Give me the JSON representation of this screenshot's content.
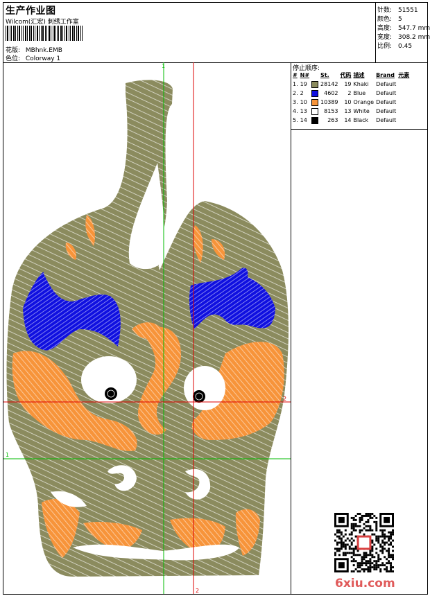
{
  "header": {
    "title": "生产作业图",
    "subtitle": "Wilcom(汇宏) 刺绣工作室",
    "pattern_label": "花版:",
    "pattern_value": "MBhnk.EMB",
    "colorway_label": "色位:",
    "colorway_value": "Colorway 1"
  },
  "stats": {
    "stitches_label": "针数:",
    "stitches_value": "51551",
    "colors_label": "颜色:",
    "colors_value": "5",
    "height_label": "高度:",
    "height_value": "547.7 mm",
    "width_label": "宽度:",
    "width_value": "308.2 mm",
    "scale_label": "比例:",
    "scale_value": "0.45"
  },
  "stop_sequence": {
    "title": "停止顺序:",
    "headers": [
      "#",
      "N#",
      "St.",
      "代码",
      "描述",
      "Brand",
      "元素"
    ],
    "rows": [
      {
        "idx": "1.",
        "needle": "19",
        "color": "#8b8b5e",
        "stitches": "28142",
        "code": "19",
        "desc": "Khaki",
        "brand": "Default"
      },
      {
        "idx": "2.",
        "needle": "2",
        "color": "#1010e0",
        "stitches": "4602",
        "code": "2",
        "desc": "Blue",
        "brand": "Default"
      },
      {
        "idx": "3.",
        "needle": "10",
        "color": "#f7943a",
        "stitches": "10389",
        "code": "10",
        "desc": "Orange",
        "brand": "Default"
      },
      {
        "idx": "4.",
        "needle": "13",
        "color": "#ffffff",
        "stitches": "8153",
        "code": "13",
        "desc": "White",
        "brand": "Default"
      },
      {
        "idx": "5.",
        "needle": "14",
        "color": "#000000",
        "stitches": "263",
        "code": "14",
        "desc": "Black",
        "brand": "Default"
      }
    ]
  },
  "guides": {
    "marker_1": "1",
    "marker_2": "2"
  },
  "watermark": "6xiu.com",
  "colors": {
    "khaki": "#8b8b5e",
    "blue": "#1010e0",
    "orange": "#f7943a",
    "guide_red": "#dd0000",
    "guide_green": "#00bb00"
  }
}
